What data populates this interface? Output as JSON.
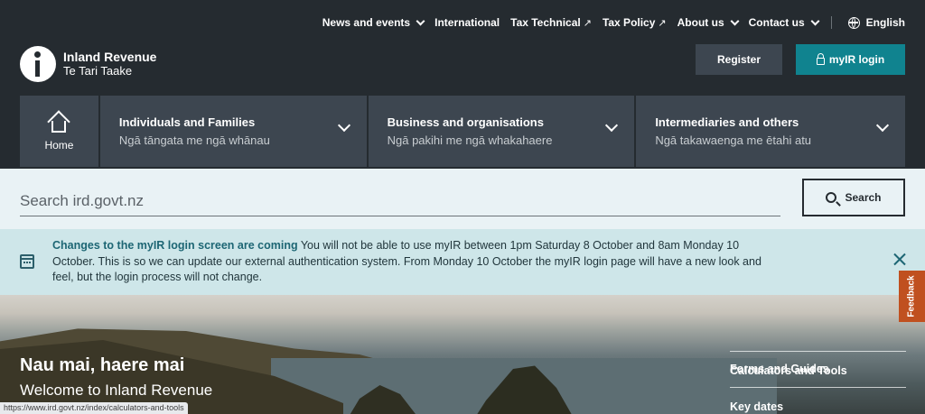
{
  "topnav": {
    "items": [
      {
        "label": "News and events",
        "icon": "chevron-down-icon"
      },
      {
        "label": "International"
      },
      {
        "label": "Tax Technical",
        "icon": "external-link-icon"
      },
      {
        "label": "Tax Policy",
        "icon": "external-link-icon"
      },
      {
        "label": "About us",
        "icon": "chevron-down-icon"
      },
      {
        "label": "Contact us",
        "icon": "chevron-down-icon"
      }
    ],
    "language": "English",
    "ext_glyph": "↗"
  },
  "logo": {
    "line1": "Inland Revenue",
    "line2": "Te Tari Taake"
  },
  "header_buttons": {
    "register": "Register",
    "myir": "myIR login"
  },
  "mainnav": {
    "home": "Home",
    "tiles": [
      {
        "title": "Individuals and Families",
        "subtitle": "Ngā tāngata me ngā whānau"
      },
      {
        "title": "Business and organisations",
        "subtitle": "Ngā pakihi me ngā whakahaere"
      },
      {
        "title": "Intermediaries and others",
        "subtitle": "Ngā takawaenga me ētahi atu"
      }
    ]
  },
  "search": {
    "placeholder": "Search ird.govt.nz",
    "button": "Search"
  },
  "alert": {
    "heading": "Changes to the myIR login screen are coming",
    "body": " You will not be able to use myIR between 1pm Saturday 8 October and 8am Monday 10 October. This is so we can update our external authentication system. From Monday 10 October the myIR login page will have a new look and feel, but the login process will not change."
  },
  "hero": {
    "title": "Nau mai, haere mai",
    "subtitle": "Welcome to Inland Revenue",
    "quick_links": [
      "Forms and Guides",
      "Calculators and Tools",
      "Key dates"
    ]
  },
  "feedback": "Feedback",
  "status_url": "https://www.ird.govt.nz/index/calculators-and-tools",
  "colors": {
    "header_bg": "#252b30",
    "tile_bg": "#3d4650",
    "accent_teal": "#10838f",
    "alert_bg": "#cee6e9",
    "feedback": "#c0501f"
  }
}
